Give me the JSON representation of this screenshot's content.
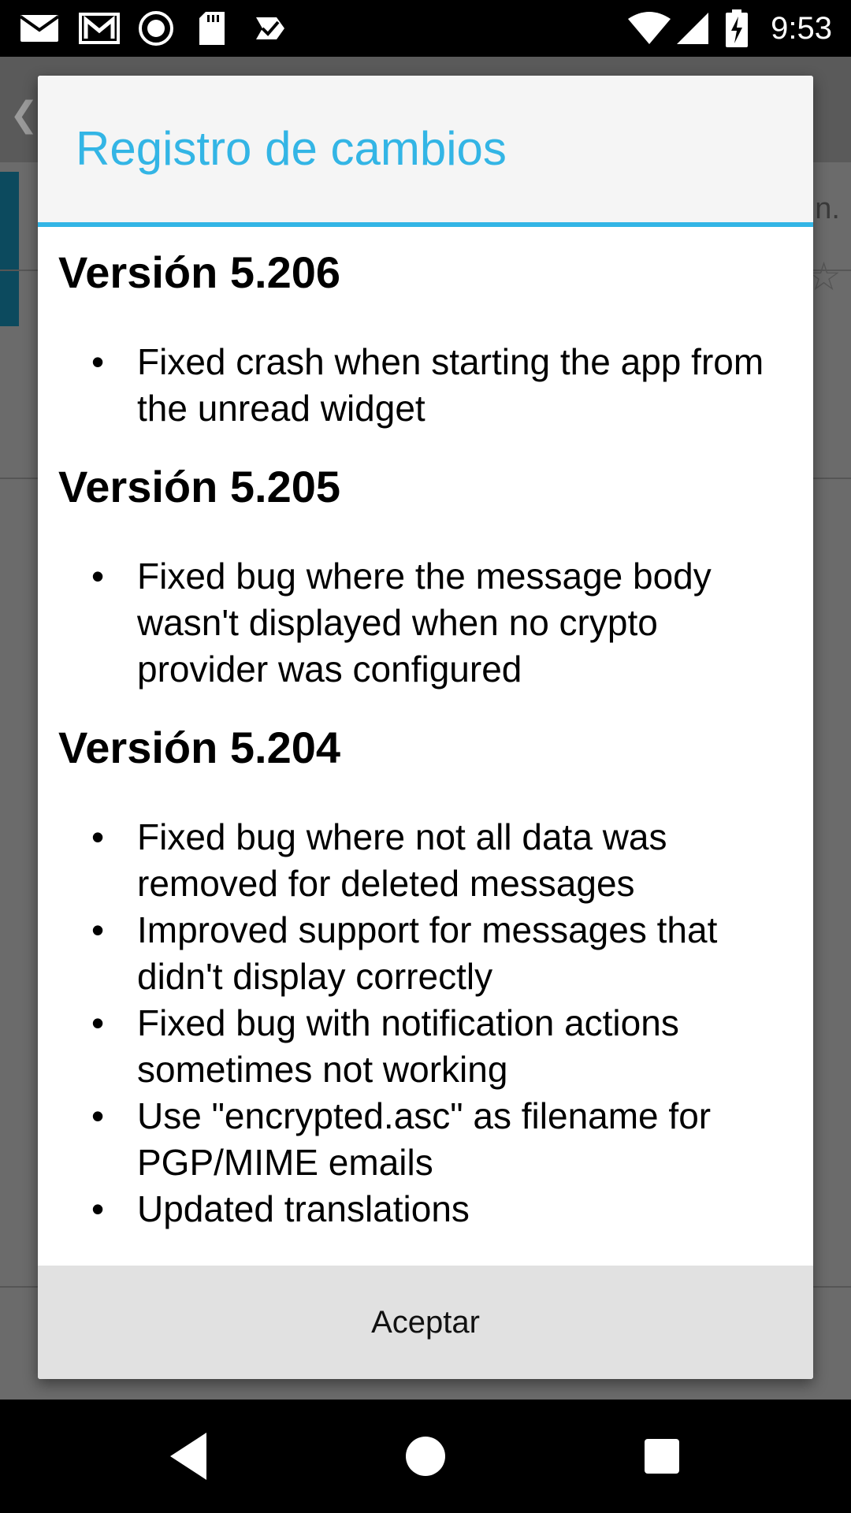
{
  "status_bar": {
    "icons": [
      "email-icon",
      "gmail-icon",
      "sync-circle-icon",
      "sd-card-icon",
      "task-check-icon"
    ],
    "system_icons": [
      "wifi-icon",
      "cell-signal-icon",
      "battery-charging-icon"
    ],
    "time": "9:53"
  },
  "dialog": {
    "title": "Registro de cambios",
    "versions": [
      {
        "label": "Versión 5.206",
        "changes": [
          [
            "Fixed crash when starting the app from",
            "the unread widget"
          ]
        ]
      },
      {
        "label": "Versión 5.205",
        "changes": [
          [
            "Fixed bug where the message body",
            "wasn't displayed when no crypto",
            "provider was configured"
          ]
        ]
      },
      {
        "label": "Versión 5.204",
        "changes": [
          [
            "Fixed bug where not all data was",
            "removed for deleted messages"
          ],
          [
            "Improved support for messages that",
            "didn't display correctly"
          ],
          [
            "Fixed bug with notification actions",
            "sometimes not working"
          ],
          [
            "Use \"encrypted.asc\" as filename for",
            "PGP/MIME emails"
          ],
          [
            "Updated translations"
          ]
        ]
      }
    ],
    "accept_label": "Aceptar"
  },
  "colors": {
    "accent": "#33b5e5",
    "status_bar": "#000000",
    "dialog_header": "#f5f5f5",
    "dialog_footer": "#e1e1e1"
  },
  "nav_bar": {
    "buttons": [
      "back-icon",
      "home-icon",
      "recents-icon"
    ]
  }
}
